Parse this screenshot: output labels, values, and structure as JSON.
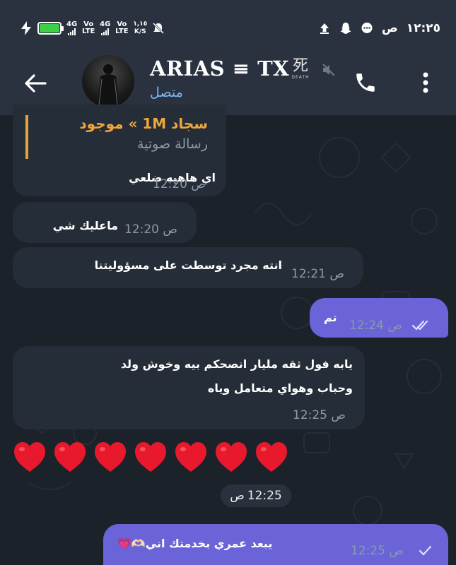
{
  "status_bar": {
    "network1_type": "4G",
    "network1_volte": "Vo LTE",
    "network2_type": "4G",
    "network2_volte": "Vo LTE",
    "speed_value": "١,١٥",
    "speed_unit": "K/S",
    "time": "١٢:٢٥",
    "am_pm": "ص"
  },
  "header": {
    "title": "ARIAS ≡ TX",
    "badge_kanji": "死",
    "badge_text": "DEATH",
    "status": "متصل"
  },
  "messages": [
    {
      "type": "incoming",
      "reply_name": "سجاد 1M » موجود",
      "reply_sub": "رسالة صوتية",
      "text": "اي هاهيه ضلعي",
      "time": "12:20",
      "ampm": "ص"
    },
    {
      "type": "incoming",
      "text": "ماعليك شي",
      "time": "12:20",
      "ampm": "ص"
    },
    {
      "type": "incoming",
      "text": "انته مجرد توسطت على مسؤوليتنا",
      "time": "12:21",
      "ampm": "ص"
    },
    {
      "type": "outgoing",
      "text": "تم",
      "time": "12:24",
      "ampm": "ص",
      "status": "read"
    },
    {
      "type": "incoming",
      "line1": "يابه فول ثقه مليار انصحكم بيه وخوش ولد",
      "line2": "وحباب وهواي متعامل وياه",
      "time": "12:25",
      "ampm": "ص"
    },
    {
      "type": "emoji",
      "hearts": 7,
      "time": "12:25",
      "ampm": "ص"
    },
    {
      "type": "outgoing",
      "text": "يبعد عمري بخدمتك اني🫶🏻💗",
      "time": "12:25",
      "ampm": "ص",
      "status": "sent"
    }
  ],
  "colors": {
    "background": "#1c222a",
    "header": "#2a3240",
    "incoming_bubble": "#252d38",
    "outgoing_bubble": "#6a64d8",
    "online_status": "#7cb4ee",
    "reply_accent": "#e3a33a"
  }
}
